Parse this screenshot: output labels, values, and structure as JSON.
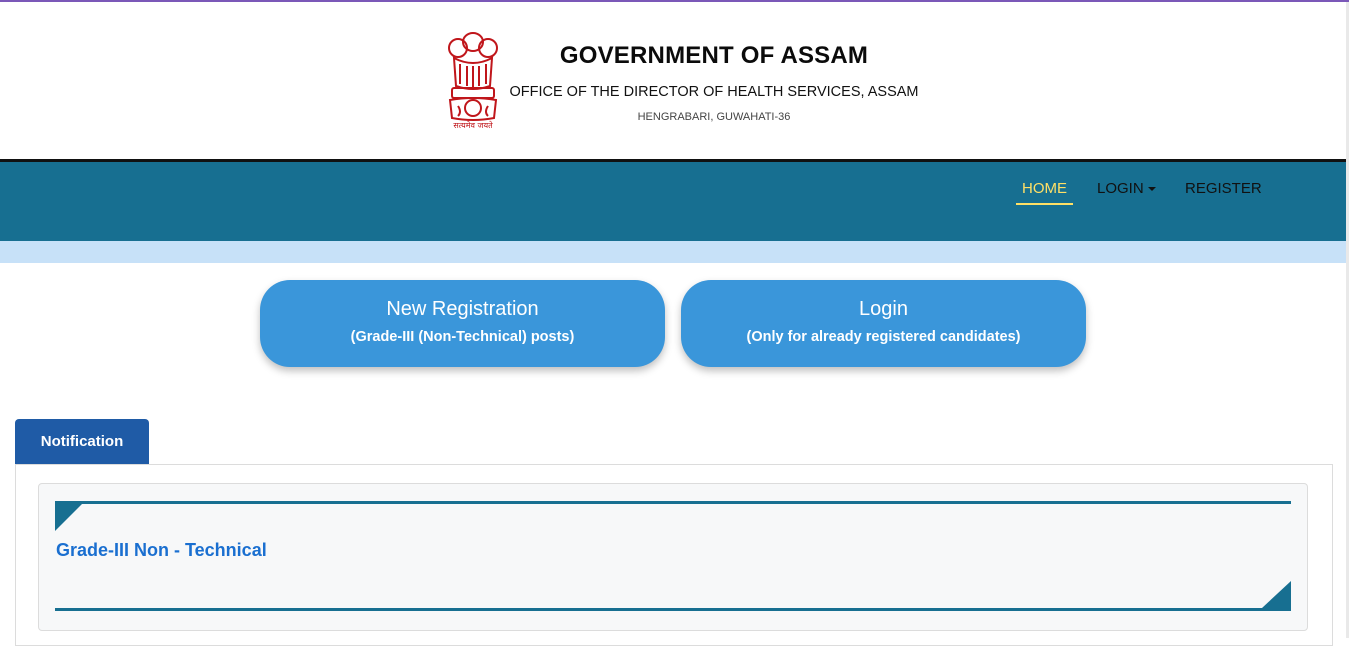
{
  "header": {
    "title": "GOVERNMENT OF ASSAM",
    "office": "OFFICE OF THE DIRECTOR OF HEALTH SERVICES, ASSAM",
    "address": "HENGRABARI, GUWAHATI-36",
    "emblem_caption": "सत्यमेव जयते"
  },
  "nav": {
    "items": [
      {
        "label": "HOME",
        "active": true
      },
      {
        "label": "LOGIN",
        "dropdown": true
      },
      {
        "label": "REGISTER"
      }
    ]
  },
  "actions": {
    "new_registration": {
      "title": "New Registration",
      "subtitle": "(Grade-III (Non-Technical) posts)"
    },
    "login": {
      "title": "Login",
      "subtitle": "(Only for already registered candidates)"
    }
  },
  "notification": {
    "tab_label": "Notification",
    "items": [
      {
        "label": "Grade-III Non - Technical"
      }
    ]
  },
  "colors": {
    "navbar": "#176f91",
    "active_nav": "#ffe066",
    "button": "#3a96da",
    "tab": "#1f5ba6",
    "link": "#1a6fd0"
  }
}
